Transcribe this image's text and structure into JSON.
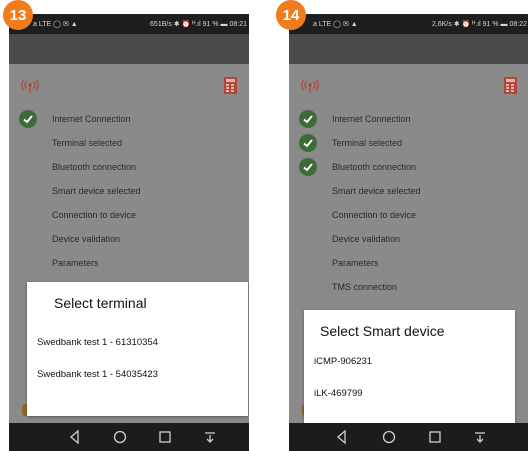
{
  "badges": {
    "left": "13",
    "right": "14"
  },
  "phone13": {
    "status_left": "a LTE ◯ ✉ ▲",
    "status_right": "651B/s ✱ ⏰ ᴴ.ıl 91 % ▬ 08:21",
    "steps": [
      {
        "label": "Internet Connection",
        "done": true
      },
      {
        "label": "Terminal selected",
        "done": false
      },
      {
        "label": "Bluetooth connection",
        "done": false
      },
      {
        "label": "Smart device selected",
        "done": false
      },
      {
        "label": "Connection to device",
        "done": false
      },
      {
        "label": "Device validation",
        "done": false
      },
      {
        "label": "Parameters",
        "done": false
      }
    ],
    "dialog": {
      "title": "Select terminal",
      "options": [
        "Swedbank test 1 - 61310354",
        "Swedbank test 1 - 54035423"
      ]
    }
  },
  "phone14": {
    "status_left": "a LTE ◯ ✉ ▲",
    "status_right": "2,6K/s ✱ ⏰ ᴴ.ıl 91 % ▬ 08:22",
    "steps": [
      {
        "label": "Internet Connection",
        "done": true
      },
      {
        "label": "Terminal selected",
        "done": true
      },
      {
        "label": "Bluetooth connection",
        "done": true
      },
      {
        "label": "Smart device selected",
        "done": false
      },
      {
        "label": "Connection to device",
        "done": false
      },
      {
        "label": "Device validation",
        "done": false
      },
      {
        "label": "Parameters",
        "done": false
      },
      {
        "label": "TMS connection",
        "done": false
      }
    ],
    "dialog": {
      "title": "Select Smart device",
      "options": [
        "iCMP-906231",
        "iLK-469799"
      ]
    }
  },
  "icons": {
    "signal": "antenna-icon",
    "calculator": "calculator-icon",
    "check": "check-circle-icon",
    "nav": [
      "back-icon",
      "home-icon",
      "recents-icon",
      "notifications-icon"
    ]
  },
  "colors": {
    "badge": "#ef7d1e",
    "check": "#3d6b3a",
    "calculator": "#b0463a",
    "overlay": "#8a8a8a"
  }
}
